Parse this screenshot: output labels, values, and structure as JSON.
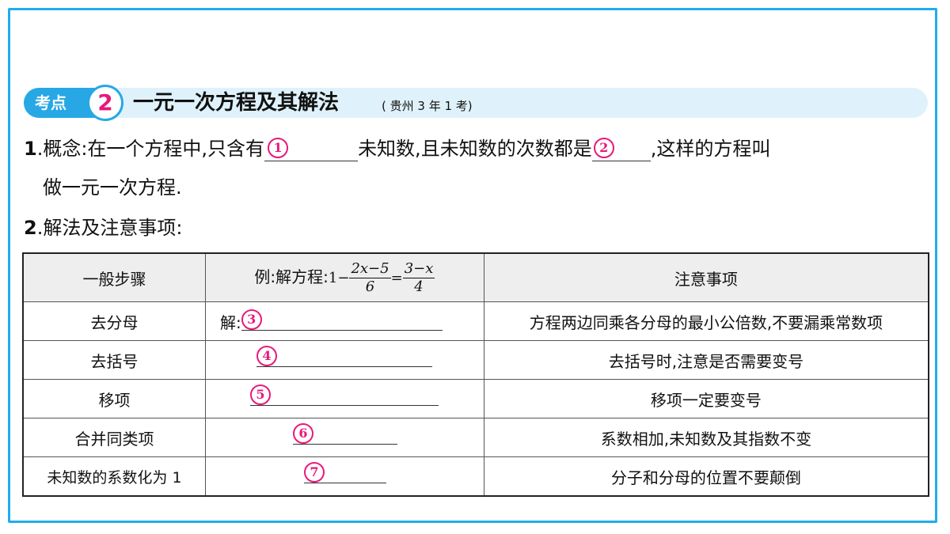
{
  "section": {
    "tag": "考点",
    "number": "2",
    "title": "一元一次方程及其解法",
    "note": "( 贵州 3 年 1 考)"
  },
  "p1": {
    "num": "1",
    "label": ".概念:",
    "text_a": "在一个方程中,只含有",
    "blank1": "1",
    "text_b": "未知数,且未知数的次数都是",
    "blank2": "2",
    "text_c": ",这样的方程叫",
    "text_d": "做一元一次方程."
  },
  "p2": {
    "num": "2",
    "label": ".解法及注意事项:"
  },
  "table": {
    "headers": {
      "col1": "一般步骤",
      "col2_prefix": "例:解方程:",
      "eq_one": "1",
      "eq_minus": "−",
      "eq_num1": "2x−5",
      "eq_den1": "6",
      "eq_equals": "=",
      "eq_num2": "3−x",
      "eq_den2": "4",
      "col3": "注意事项"
    },
    "rows": [
      {
        "step": "去分母",
        "prefix": "解:",
        "blank": "3",
        "note": "方程两边同乘各分母的最小公倍数,不要漏乘常数项"
      },
      {
        "step": "去括号",
        "prefix": "",
        "blank": "4",
        "note": "去括号时,注意是否需要变号"
      },
      {
        "step": "移项",
        "prefix": "",
        "blank": "5",
        "note": "移项一定要变号"
      },
      {
        "step": "合并同类项",
        "prefix": "",
        "blank": "6",
        "note": "系数相加,未知数及其指数不变"
      },
      {
        "step": "未知数的系数化为 1",
        "prefix": "",
        "blank": "7",
        "note": "分子和分母的位置不要颠倒"
      }
    ]
  },
  "colors": {
    "frame": "#1eaee8",
    "accent": "#27a8e5",
    "highlight": "#e8197b",
    "header_bg": "#dff2fb"
  }
}
